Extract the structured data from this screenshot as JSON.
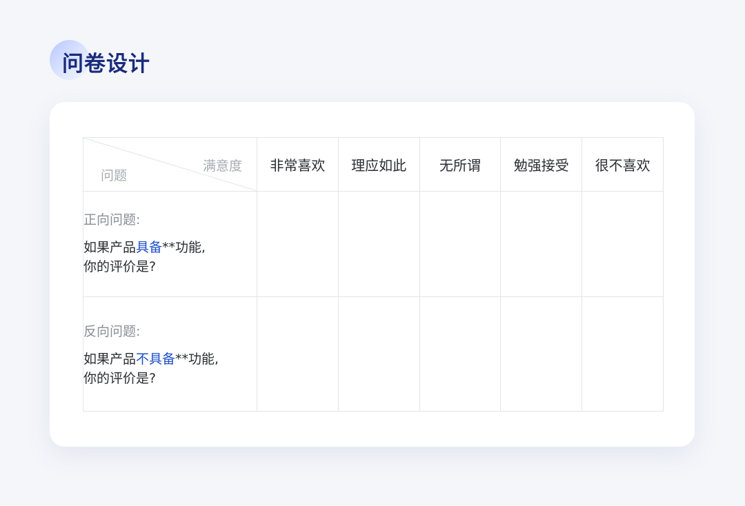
{
  "page": {
    "title": "问卷设计"
  },
  "table": {
    "corner": {
      "top_label": "满意度",
      "bottom_label": "问题"
    },
    "options": [
      "非常喜欢",
      "理应如此",
      "无所谓",
      "勉强接受",
      "很不喜欢"
    ],
    "rows": [
      {
        "label": "正向问题:",
        "text_before": "如果产品",
        "highlight": "具备",
        "text_after": "**功能,",
        "line2": "你的评价是?"
      },
      {
        "label": "反向问题:",
        "text_before": "如果产品",
        "highlight": "不具备",
        "text_after": "**功能,",
        "line2": "你的评价是?"
      }
    ]
  },
  "colors": {
    "title": "#1a2b7c",
    "highlight": "#1f4fc8",
    "background": "#f4f6fa"
  }
}
